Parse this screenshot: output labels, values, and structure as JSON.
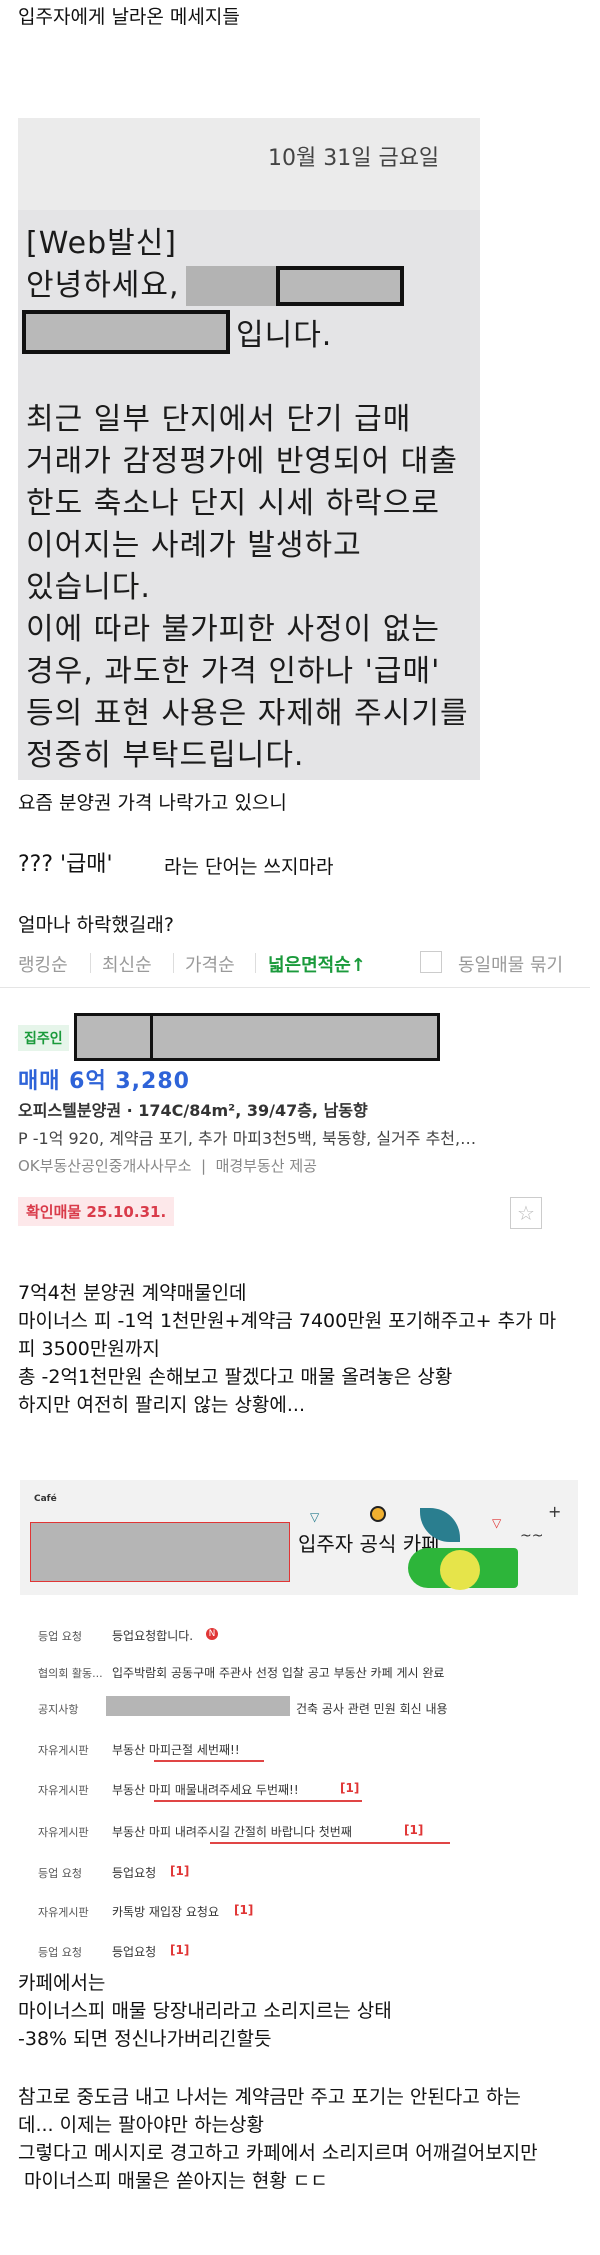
{
  "post": {
    "title": "입주자에게 날라온 메세지들",
    "caption1": "요즘 분양권 가격 나락가고 있으니",
    "caption2_prefix": "??? '급매'",
    "caption2_suffix": " 라는 단어는 쓰지마라",
    "caption3": "얼마나 하락했길래?",
    "paragraph1": [
      "7억4천 분양권 계약매물인데",
      "마이너스 피 -1억 1천만원+계약금 7400만원 포기해주고+ 추가 마",
      "피 3500만원까지",
      "총 -2억1천만원 손해보고 팔겠다고 매물 올려놓은 상황",
      "하지만 여전히 팔리지 않는 상황에..."
    ],
    "paragraph2": [
      "카페에서는",
      "마이너스피 매물 당장내리라고 소리지르는 상태",
      "-38% 되면 정신나가버리긴할듯"
    ],
    "paragraph3": [
      "참고로 중도금 내고 나서는 계약금만 주고 포기는 안된다고 하는",
      "데... 이제는 팔아야만 하는상황",
      "그렇다고 메시지로 경고하고 카페에서 소리지르며 어깨걸어보지만",
      " 마이너스피 매물은 쏟아지는 현황 ㄷㄷ"
    ]
  },
  "sms": {
    "date": "10월 31일 금요일",
    "lines": [
      "[Web발신]",
      "안녕하세요,",
      "입니다.",
      "",
      "최근 일부 단지에서 단기 급매",
      "거래가 감정평가에 반영되어 대출",
      "한도 축소나 단지 시세 하락으로",
      "이어지는 사례가 발생하고",
      "있습니다.",
      "이에 따라 불가피한 사정이 없는",
      "경우, 과도한 가격 인하나 '급매'",
      "등의 표현 사용은 자제해 주시기를",
      "정중히 부탁드립니다."
    ]
  },
  "listing": {
    "sort_tabs": [
      "랭킹순",
      "최신순",
      "가격순",
      "넓은면적순↑"
    ],
    "active_tab": "넓은면적순↑",
    "same_listing_label": "동일매물 묶기",
    "owner_tag": "집주인",
    "price": "매매 6억 3,280",
    "type_line": "오피스텔분양권 · 174C/84m², 39/47층, 남동향",
    "premium_line": "P -1억 920, 계약금 포기, 추가 마피3천5백, 북동향, 실거주 추천,…",
    "agency_line": "OK부동산공인중개사사무소  |  매경부동산 제공",
    "confirm_badge": "확인매물 25.10.31.",
    "star_icon": "star-icon"
  },
  "cafe": {
    "logo": "Café",
    "title": "입주자 공식 카페",
    "rows": [
      {
        "label": "등업 요청",
        "text": "등업요청합니다.",
        "num": ""
      },
      {
        "label": "협의회 활동...",
        "text": "입주박람회 공동구매 주관사 선정 입찰 공고 부동산 카페 게시 완료",
        "num": ""
      },
      {
        "label": "공지사항",
        "text": "건축 공사 관련 민원 회신 내용",
        "num": ""
      },
      {
        "label": "자유게시판",
        "text": "부동산 마피근절 세번째!!",
        "num": ""
      },
      {
        "label": "자유게시판",
        "text": "부동산 마피 매물내려주세요 두번째!!",
        "num": "[1]"
      },
      {
        "label": "자유게시판",
        "text": "부동산 마피 내려주시길 간절히 바랍니다 첫번째",
        "num": "[1]"
      },
      {
        "label": "등업 요청",
        "text": "등업요청",
        "num": "[1]"
      },
      {
        "label": "자유게시판",
        "text": "카톡방 재입장 요청요",
        "num": "[1]"
      },
      {
        "label": "등업 요청",
        "text": "등업요청",
        "num": "[1]"
      }
    ]
  },
  "colors": {
    "price_blue": "#2e63d8",
    "active_green": "#1a9a3b",
    "badge_red": "#d93b4a",
    "cafe_green": "#2db53a"
  }
}
